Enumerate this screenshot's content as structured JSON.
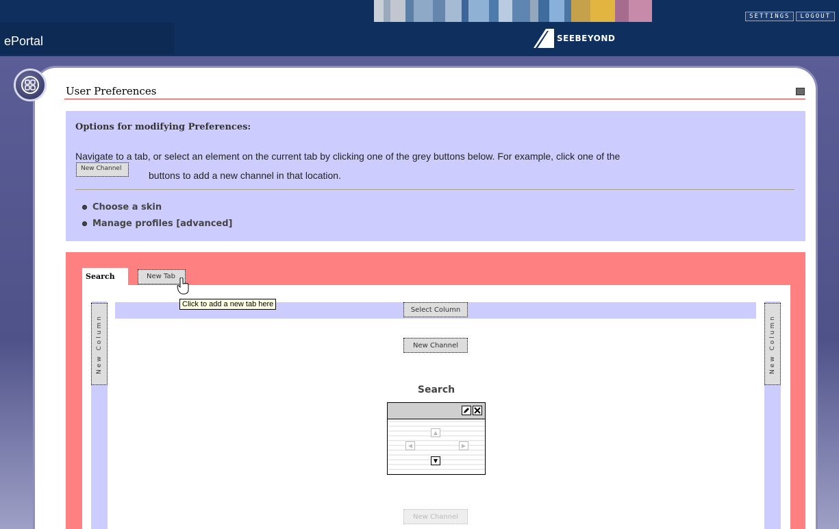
{
  "header": {
    "app_name": "ePortal",
    "settings_label": "SETTINGS",
    "logout_label": "LOGOUT",
    "brand": "SEEBEYOND",
    "strip_colors": [
      "#c9d0d8",
      "#9aa9bb",
      "#c2c6cf",
      "#5c7fa6",
      "#8ea9c8",
      "#6786ad",
      "#a4bbd3",
      "#3c6699",
      "#8fb2d4",
      "#4d7bab",
      "#b9cbe0",
      "#5f85b1",
      "#95a7bd",
      "#3f6c9c",
      "#89b0d9",
      "#4b76a3",
      "#c4a14a",
      "#e1b53f",
      "#a56c8e",
      "#c88aa9"
    ]
  },
  "page": {
    "title": "User Preferences"
  },
  "options": {
    "heading": "Options for modifying Preferences:",
    "text_part1": "Navigate to a tab, or select an element on the current tab by clicking one of the grey buttons below. For example, click one of the",
    "inline_button": "New Channel",
    "text_part2": "buttons to add a new channel in that location.",
    "links": [
      "Choose a skin",
      "Manage profiles [advanced]"
    ]
  },
  "layout": {
    "tabs": {
      "active": "Search",
      "new_tab": "New Tab"
    },
    "tooltip": "Click to add a new tab here",
    "new_column": "New Column",
    "select_column": "Select Column",
    "new_channel": "New Channel",
    "channel": {
      "title": "Search",
      "edit_icon": "pencil-icon",
      "close_icon": "close-icon"
    }
  },
  "colors": {
    "header_bg": "#0f2f5e",
    "frame": "#5b5d96",
    "options_bg": "#ccccff",
    "layout_bg": "#ff8080",
    "title_rule": "#e03a3a"
  }
}
